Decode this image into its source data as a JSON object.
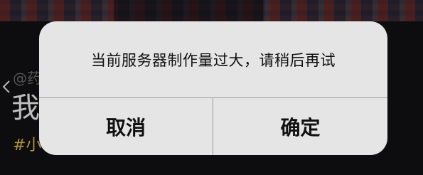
{
  "background": {
    "author_handle": "@药",
    "title_text": "我",
    "hashtag": "#小",
    "tag_color": "#d9b548"
  },
  "alert": {
    "message": "当前服务器制作量过大，请稍后再试",
    "cancel_label": "取消",
    "confirm_label": "确定",
    "background_color": "#e5e5e5"
  },
  "icons": {
    "back": "chevron-left-icon"
  }
}
